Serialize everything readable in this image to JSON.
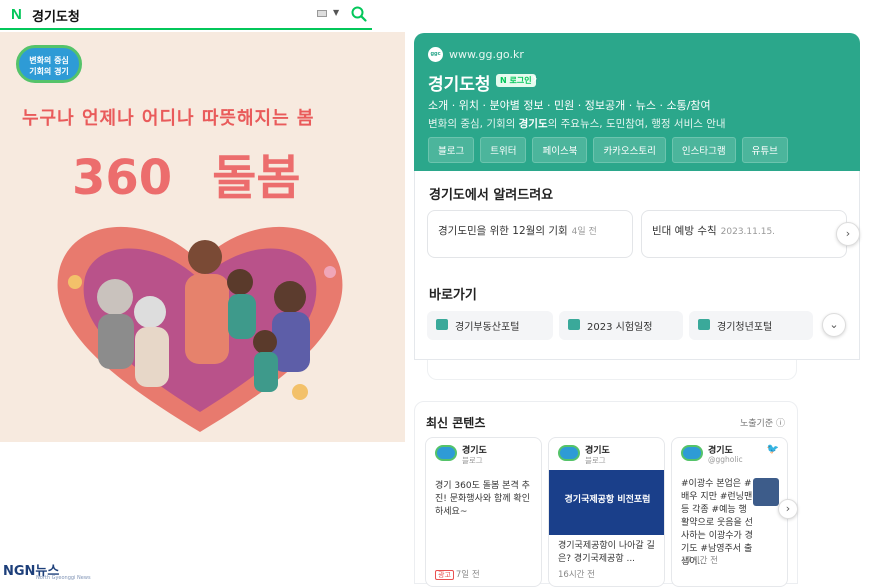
{
  "search": {
    "logo": "N",
    "query": "경기도청"
  },
  "banner": {
    "badge_line1": "변화의 중심",
    "badge_line2": "기회의 경기",
    "slogan": "누구나 언제나 어디나 따뜻해지는 봄",
    "big_number": "360",
    "big_word": "돌봄"
  },
  "site": {
    "url": "www.gg.go.kr",
    "title": "경기도청",
    "login_badge": "N 로그인",
    "links": "소개 · 위치 · 분야별 정보 · 민원 · 정보공개 · 뉴스 · 소통/참여",
    "desc_pre": "변화의 중심, 기회의 ",
    "desc_bold": "경기도",
    "desc_post": "의 주요뉴스, 도민참여, 행정 서비스 안내",
    "chips": [
      "블로그",
      "트위터",
      "페이스북",
      "카카오스토리",
      "인스타그램",
      "유튜브"
    ],
    "accent": "#2ba78b"
  },
  "notices": {
    "title": "경기도에서 알려드려요",
    "items": [
      {
        "text": "경기도민을 위한 12월의 기회",
        "time": "4일 전"
      },
      {
        "text": "빈대 예방 수칙",
        "time": "2023.11.15."
      }
    ]
  },
  "shortcuts": {
    "title": "바로가기",
    "items": [
      "경기부동산포털",
      "2023 시험일정",
      "경기청년포털"
    ]
  },
  "latest": {
    "title": "최신 콘텐츠",
    "criterion": "노출기준",
    "cards": [
      {
        "name": "경기도",
        "source": "블로그",
        "body": "경기 360도 돌봄 본격 추진! 문화행사와 함께 확인하세요~",
        "ad": "광고",
        "time": "7일 전"
      },
      {
        "name": "경기도",
        "source": "블로그",
        "image_title": "경기국제공항 비전포럼",
        "body": "경기국제공항이 나아갈 길은? 경기국제공항 ...",
        "time": "16시간 전"
      },
      {
        "name": "경기도",
        "source": "@ggholic",
        "body": "#이광수 본업은 #배우 지만 #런닝맨 등 각종 #예능 행활약으로 웃음을 선사하는 이광수가 경기도 #남영주서 출생이...",
        "time": "17시간 전"
      }
    ]
  },
  "footer": {
    "logo": "NGN뉴스",
    "sub": "North Gyeonggi News"
  }
}
